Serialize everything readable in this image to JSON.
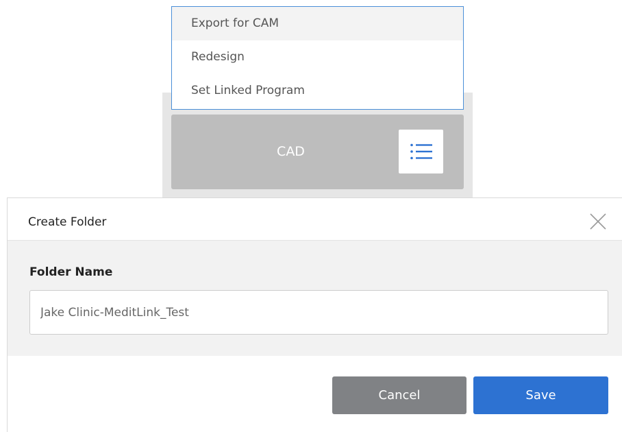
{
  "context_menu": {
    "items": [
      {
        "label": "Export for CAM",
        "state": "hover"
      },
      {
        "label": "Redesign",
        "state": "normal"
      },
      {
        "label": "Set Linked Program",
        "state": "normal"
      }
    ]
  },
  "cad_card": {
    "label": "CAD",
    "menu_icon": "list-icon"
  },
  "dialog": {
    "title": "Create Folder",
    "close_icon": "close-icon",
    "field_label": "Folder Name",
    "folder_name_value": "Jake Clinic-MeditLink_Test",
    "cancel_label": "Cancel",
    "save_label": "Save"
  },
  "colors": {
    "accent": "#2d72d2",
    "cancel": "#808285",
    "card": "#bdbdbd",
    "menu_border": "#4a8fd8"
  }
}
